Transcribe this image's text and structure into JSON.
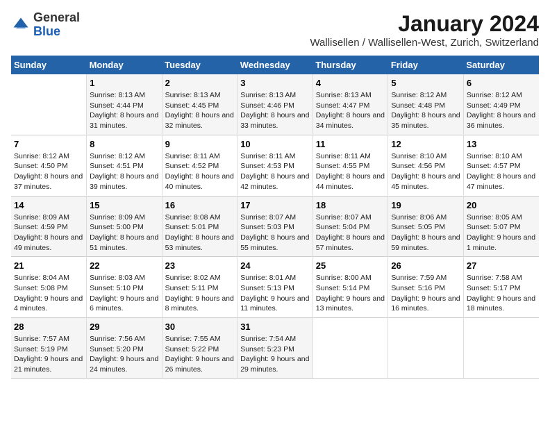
{
  "logo": {
    "general": "General",
    "blue": "Blue"
  },
  "header": {
    "title": "January 2024",
    "subtitle": "Wallisellen / Wallisellen-West, Zurich, Switzerland"
  },
  "weekdays": [
    "Sunday",
    "Monday",
    "Tuesday",
    "Wednesday",
    "Thursday",
    "Friday",
    "Saturday"
  ],
  "weeks": [
    [
      {
        "day": null,
        "info": null
      },
      {
        "day": "1",
        "sunrise": "Sunrise: 8:13 AM",
        "sunset": "Sunset: 4:44 PM",
        "daylight": "Daylight: 8 hours and 31 minutes."
      },
      {
        "day": "2",
        "sunrise": "Sunrise: 8:13 AM",
        "sunset": "Sunset: 4:45 PM",
        "daylight": "Daylight: 8 hours and 32 minutes."
      },
      {
        "day": "3",
        "sunrise": "Sunrise: 8:13 AM",
        "sunset": "Sunset: 4:46 PM",
        "daylight": "Daylight: 8 hours and 33 minutes."
      },
      {
        "day": "4",
        "sunrise": "Sunrise: 8:13 AM",
        "sunset": "Sunset: 4:47 PM",
        "daylight": "Daylight: 8 hours and 34 minutes."
      },
      {
        "day": "5",
        "sunrise": "Sunrise: 8:12 AM",
        "sunset": "Sunset: 4:48 PM",
        "daylight": "Daylight: 8 hours and 35 minutes."
      },
      {
        "day": "6",
        "sunrise": "Sunrise: 8:12 AM",
        "sunset": "Sunset: 4:49 PM",
        "daylight": "Daylight: 8 hours and 36 minutes."
      }
    ],
    [
      {
        "day": "7",
        "sunrise": "Sunrise: 8:12 AM",
        "sunset": "Sunset: 4:50 PM",
        "daylight": "Daylight: 8 hours and 37 minutes."
      },
      {
        "day": "8",
        "sunrise": "Sunrise: 8:12 AM",
        "sunset": "Sunset: 4:51 PM",
        "daylight": "Daylight: 8 hours and 39 minutes."
      },
      {
        "day": "9",
        "sunrise": "Sunrise: 8:11 AM",
        "sunset": "Sunset: 4:52 PM",
        "daylight": "Daylight: 8 hours and 40 minutes."
      },
      {
        "day": "10",
        "sunrise": "Sunrise: 8:11 AM",
        "sunset": "Sunset: 4:53 PM",
        "daylight": "Daylight: 8 hours and 42 minutes."
      },
      {
        "day": "11",
        "sunrise": "Sunrise: 8:11 AM",
        "sunset": "Sunset: 4:55 PM",
        "daylight": "Daylight: 8 hours and 44 minutes."
      },
      {
        "day": "12",
        "sunrise": "Sunrise: 8:10 AM",
        "sunset": "Sunset: 4:56 PM",
        "daylight": "Daylight: 8 hours and 45 minutes."
      },
      {
        "day": "13",
        "sunrise": "Sunrise: 8:10 AM",
        "sunset": "Sunset: 4:57 PM",
        "daylight": "Daylight: 8 hours and 47 minutes."
      }
    ],
    [
      {
        "day": "14",
        "sunrise": "Sunrise: 8:09 AM",
        "sunset": "Sunset: 4:59 PM",
        "daylight": "Daylight: 8 hours and 49 minutes."
      },
      {
        "day": "15",
        "sunrise": "Sunrise: 8:09 AM",
        "sunset": "Sunset: 5:00 PM",
        "daylight": "Daylight: 8 hours and 51 minutes."
      },
      {
        "day": "16",
        "sunrise": "Sunrise: 8:08 AM",
        "sunset": "Sunset: 5:01 PM",
        "daylight": "Daylight: 8 hours and 53 minutes."
      },
      {
        "day": "17",
        "sunrise": "Sunrise: 8:07 AM",
        "sunset": "Sunset: 5:03 PM",
        "daylight": "Daylight: 8 hours and 55 minutes."
      },
      {
        "day": "18",
        "sunrise": "Sunrise: 8:07 AM",
        "sunset": "Sunset: 5:04 PM",
        "daylight": "Daylight: 8 hours and 57 minutes."
      },
      {
        "day": "19",
        "sunrise": "Sunrise: 8:06 AM",
        "sunset": "Sunset: 5:05 PM",
        "daylight": "Daylight: 8 hours and 59 minutes."
      },
      {
        "day": "20",
        "sunrise": "Sunrise: 8:05 AM",
        "sunset": "Sunset: 5:07 PM",
        "daylight": "Daylight: 9 hours and 1 minute."
      }
    ],
    [
      {
        "day": "21",
        "sunrise": "Sunrise: 8:04 AM",
        "sunset": "Sunset: 5:08 PM",
        "daylight": "Daylight: 9 hours and 4 minutes."
      },
      {
        "day": "22",
        "sunrise": "Sunrise: 8:03 AM",
        "sunset": "Sunset: 5:10 PM",
        "daylight": "Daylight: 9 hours and 6 minutes."
      },
      {
        "day": "23",
        "sunrise": "Sunrise: 8:02 AM",
        "sunset": "Sunset: 5:11 PM",
        "daylight": "Daylight: 9 hours and 8 minutes."
      },
      {
        "day": "24",
        "sunrise": "Sunrise: 8:01 AM",
        "sunset": "Sunset: 5:13 PM",
        "daylight": "Daylight: 9 hours and 11 minutes."
      },
      {
        "day": "25",
        "sunrise": "Sunrise: 8:00 AM",
        "sunset": "Sunset: 5:14 PM",
        "daylight": "Daylight: 9 hours and 13 minutes."
      },
      {
        "day": "26",
        "sunrise": "Sunrise: 7:59 AM",
        "sunset": "Sunset: 5:16 PM",
        "daylight": "Daylight: 9 hours and 16 minutes."
      },
      {
        "day": "27",
        "sunrise": "Sunrise: 7:58 AM",
        "sunset": "Sunset: 5:17 PM",
        "daylight": "Daylight: 9 hours and 18 minutes."
      }
    ],
    [
      {
        "day": "28",
        "sunrise": "Sunrise: 7:57 AM",
        "sunset": "Sunset: 5:19 PM",
        "daylight": "Daylight: 9 hours and 21 minutes."
      },
      {
        "day": "29",
        "sunrise": "Sunrise: 7:56 AM",
        "sunset": "Sunset: 5:20 PM",
        "daylight": "Daylight: 9 hours and 24 minutes."
      },
      {
        "day": "30",
        "sunrise": "Sunrise: 7:55 AM",
        "sunset": "Sunset: 5:22 PM",
        "daylight": "Daylight: 9 hours and 26 minutes."
      },
      {
        "day": "31",
        "sunrise": "Sunrise: 7:54 AM",
        "sunset": "Sunset: 5:23 PM",
        "daylight": "Daylight: 9 hours and 29 minutes."
      },
      {
        "day": null,
        "info": null
      },
      {
        "day": null,
        "info": null
      },
      {
        "day": null,
        "info": null
      }
    ]
  ]
}
